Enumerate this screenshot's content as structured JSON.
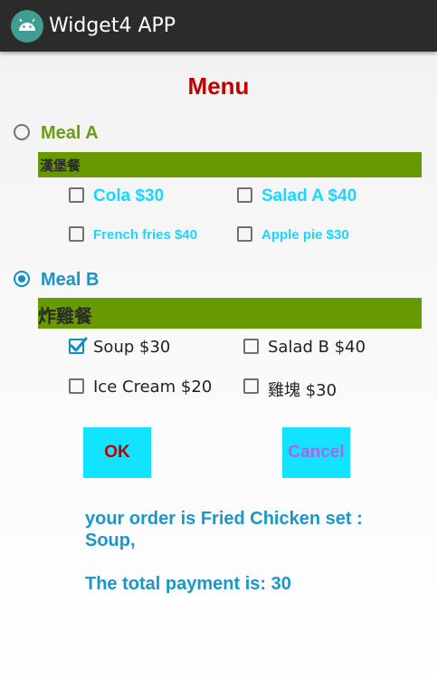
{
  "app": {
    "title": "Widget4 APP",
    "icon": "android-icon"
  },
  "menu": {
    "title": "Menu"
  },
  "meal_a": {
    "label": "Meal A",
    "checked": false,
    "name": "漢堡餐",
    "items": [
      {
        "label": "Cola $30",
        "checked": false
      },
      {
        "label": "Salad A $40",
        "checked": false
      },
      {
        "label": "French fries $40",
        "checked": false
      },
      {
        "label": "Apple pie $30",
        "checked": false
      }
    ]
  },
  "meal_b": {
    "label": "Meal B",
    "checked": true,
    "name": "炸雞餐",
    "items": [
      {
        "label": "Soup $30",
        "checked": true
      },
      {
        "label": "Salad B $40",
        "checked": false
      },
      {
        "label": "Ice Cream $20",
        "checked": false
      },
      {
        "label": "雞塊 $30",
        "checked": false
      }
    ]
  },
  "buttons": {
    "ok_label": "OK",
    "cancel_label": "Cancel"
  },
  "result": {
    "order_line1": "your order is Fried Chicken set :",
    "order_line2": "Soup,",
    "payment": "The total payment is: 30"
  },
  "colors": {
    "menu_title": "#c00000",
    "meal_a_label": "#6b9c13",
    "meal_b_label": "#1c93c6",
    "band": "#679a00",
    "button_bg": "#12e3ff",
    "ok_text": "#c00000",
    "cancel_text": "#b45fe0"
  }
}
